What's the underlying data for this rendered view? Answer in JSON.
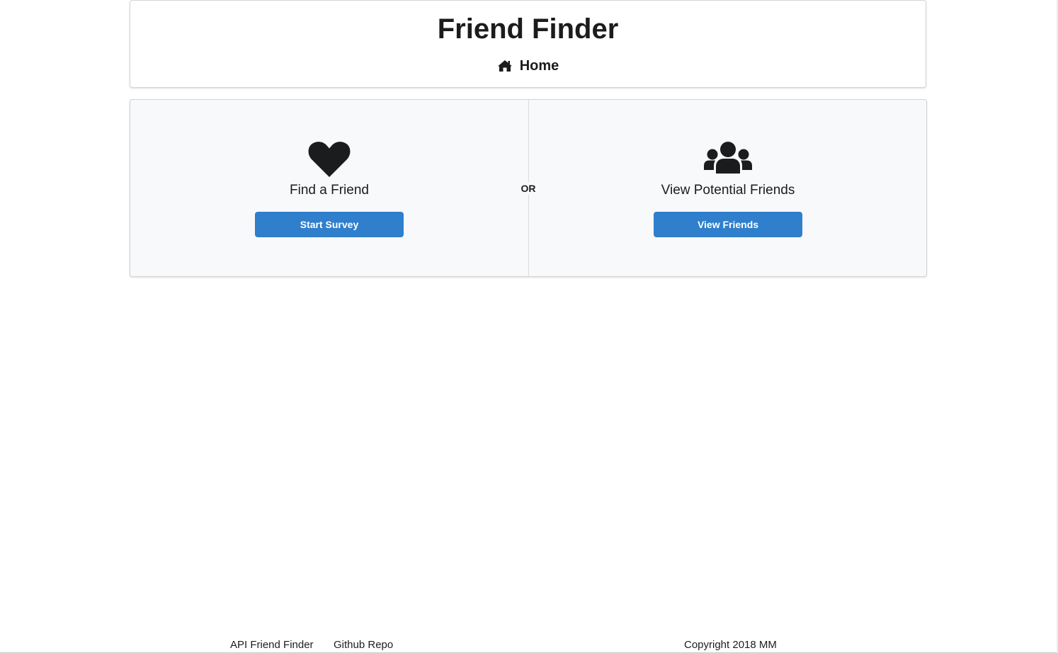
{
  "header": {
    "title": "Friend Finder",
    "home_label": "Home",
    "home_icon": "home-icon"
  },
  "main": {
    "divider_label": "OR",
    "left": {
      "icon": "heart-icon",
      "title": "Find a Friend",
      "button_label": "Start Survey"
    },
    "right": {
      "icon": "users-icon",
      "title": "View Potential Friends",
      "button_label": "View Friends"
    }
  },
  "footer": {
    "link_api": "API Friend Finder",
    "link_github": "Github Repo",
    "copyright": "Copyright 2018 MM"
  },
  "colors": {
    "button_bg": "#2f7fcd",
    "segment_bg": "#f8f9fa",
    "text": "#1b1c1d"
  }
}
